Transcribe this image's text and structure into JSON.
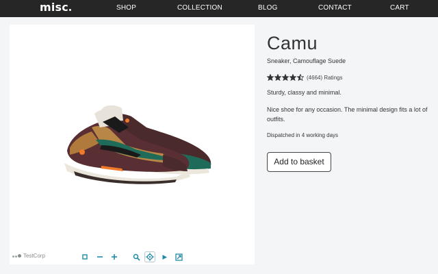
{
  "nav": {
    "logo": "misc",
    "items": [
      "SHOP",
      "COLLECTION",
      "BLOG",
      "CONTACT",
      "CART"
    ]
  },
  "viewer": {
    "watermark": "TestCorp",
    "tools": [
      "fit-icon",
      "zoom-out-icon",
      "zoom-in-icon",
      "magnifier-icon",
      "pan-crosshair-icon",
      "play-icon",
      "fullscreen-icon"
    ],
    "active_tool": "pan-crosshair-icon",
    "tool_color": "#1e8aa8"
  },
  "product": {
    "title": "Camu",
    "subtitle": "Sneaker, Camouflage Suede",
    "rating": 4.5,
    "rating_max": 5,
    "rating_count": "(4664) Ratings",
    "tagline": "Sturdy, classy and minimal.",
    "description": "Nice shoe for any occasion. The minimal design fits a lot of outfits.",
    "dispatch": "Dispatched in 4 working days",
    "add_button": "Add to basket"
  },
  "colors": {
    "navbar": "#262626",
    "page": "#f4f5f7",
    "star": "#333333"
  }
}
